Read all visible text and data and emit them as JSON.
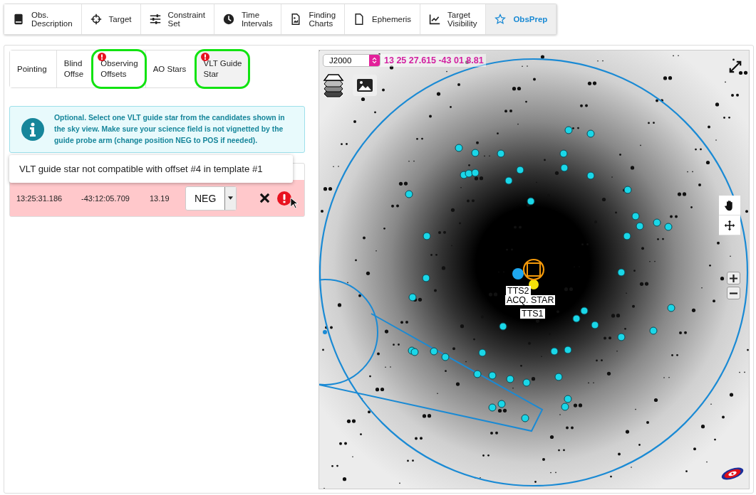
{
  "tabs": [
    {
      "label": "Obs.\nDescription",
      "kind": "description",
      "selected": false
    },
    {
      "label": "Target",
      "kind": "target",
      "selected": false
    },
    {
      "label": "Constraint\nSet",
      "kind": "constraints",
      "selected": false
    },
    {
      "label": "Time\nIntervals",
      "kind": "time",
      "selected": false
    },
    {
      "label": "Finding\nCharts",
      "kind": "charts",
      "selected": false
    },
    {
      "label": "Ephemeris",
      "kind": "ephemeris",
      "selected": false
    },
    {
      "label": "Target\nVisibility",
      "kind": "visibility",
      "selected": false
    },
    {
      "label": "ObsPrep",
      "kind": "obsprep",
      "selected": true
    }
  ],
  "steps": [
    {
      "label": "Pointing",
      "selected": false,
      "error": false,
      "highlighted": false
    },
    {
      "label": "Blind\nOffse",
      "selected": false,
      "error": false,
      "highlighted": false
    },
    {
      "label": "Observing\nOffsets",
      "selected": false,
      "error": true,
      "highlighted": true
    },
    {
      "label": "AO Stars",
      "selected": false,
      "error": false,
      "highlighted": false
    },
    {
      "label": "VLT Guide\nStar",
      "selected": true,
      "error": true,
      "highlighted": true
    }
  ],
  "info": "Optional. Select one VLT guide star from the candidates shown in the sky view. Make sure your science field is not vignetted by the guide probe arm (change position NEG to POS if needed).",
  "tooltip": "VLT guide star not compatible with offset #4 in template #1",
  "guide_star": {
    "ra": "13:25:31.186",
    "dec": "-43:12:05.709",
    "mag": "13.19",
    "position": "NEG",
    "error": true
  },
  "sky": {
    "frame": "J2000",
    "coords": "13 25 27.615 -43 01 8.81",
    "labels": [
      {
        "text": "TTS2",
        "kind": "tts2"
      },
      {
        "text": "ACQ. STAR",
        "kind": "acq"
      },
      {
        "text": "TTS1",
        "kind": "tts1"
      }
    ]
  }
}
